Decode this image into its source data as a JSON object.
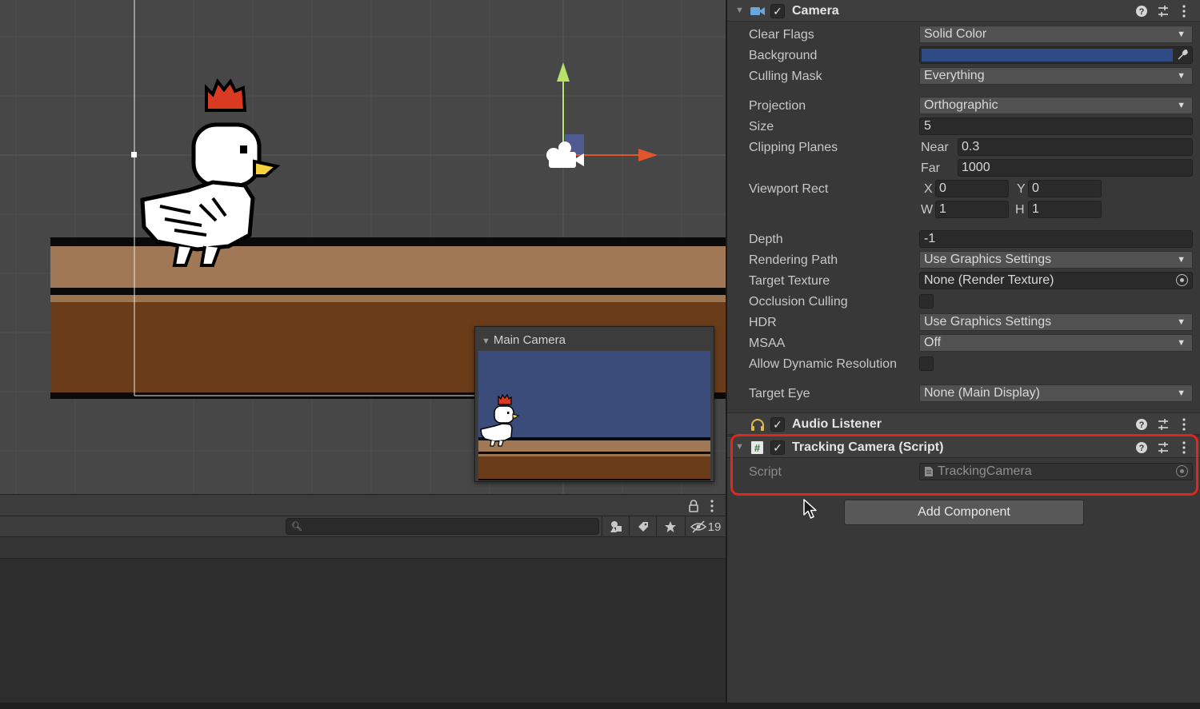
{
  "scene": {
    "preview_title": "Main Camera",
    "colors": {
      "background": "#474747",
      "ground_top": "#a07855",
      "ground_bottom": "#6b3c1a",
      "preview_sky": "#3b4b7a"
    }
  },
  "bottom_panel": {
    "search": {
      "value": "",
      "placeholder": ""
    },
    "hidden_count": "19",
    "icons": [
      "lock-icon",
      "menu-icon",
      "search-icon",
      "filter-type-icon",
      "label-icon",
      "favorite-icon",
      "hidden-eye-icon"
    ]
  },
  "inspector": {
    "camera": {
      "title": "Camera",
      "enabled": true,
      "fields": {
        "clear_flags": {
          "label": "Clear Flags",
          "value": "Solid Color"
        },
        "background": {
          "label": "Background",
          "color": "#2f4b86"
        },
        "culling_mask": {
          "label": "Culling Mask",
          "value": "Everything"
        },
        "projection": {
          "label": "Projection",
          "value": "Orthographic"
        },
        "size": {
          "label": "Size",
          "value": "5"
        },
        "clipping_planes": {
          "label": "Clipping Planes",
          "near_label": "Near",
          "near": "0.3",
          "far_label": "Far",
          "far": "1000"
        },
        "viewport_rect": {
          "label": "Viewport Rect",
          "x_label": "X",
          "x": "0",
          "y_label": "Y",
          "y": "0",
          "w_label": "W",
          "w": "1",
          "h_label": "H",
          "h": "1"
        },
        "depth": {
          "label": "Depth",
          "value": "-1"
        },
        "rendering_path": {
          "label": "Rendering Path",
          "value": "Use Graphics Settings"
        },
        "target_texture": {
          "label": "Target Texture",
          "value": "None (Render Texture)"
        },
        "occlusion_culling": {
          "label": "Occlusion Culling",
          "checked": false
        },
        "hdr": {
          "label": "HDR",
          "value": "Use Graphics Settings"
        },
        "msaa": {
          "label": "MSAA",
          "value": "Off"
        },
        "allow_dynamic_resolution": {
          "label": "Allow Dynamic Resolution",
          "checked": false
        },
        "target_eye": {
          "label": "Target Eye",
          "value": "None (Main Display)"
        }
      }
    },
    "audio_listener": {
      "title": "Audio Listener",
      "enabled": true
    },
    "tracking_camera": {
      "title": "Tracking Camera (Script)",
      "enabled": true,
      "script_label": "Script",
      "script_value": "TrackingCamera",
      "highlight_color": "#e1261c"
    },
    "add_component_label": "Add Component"
  }
}
